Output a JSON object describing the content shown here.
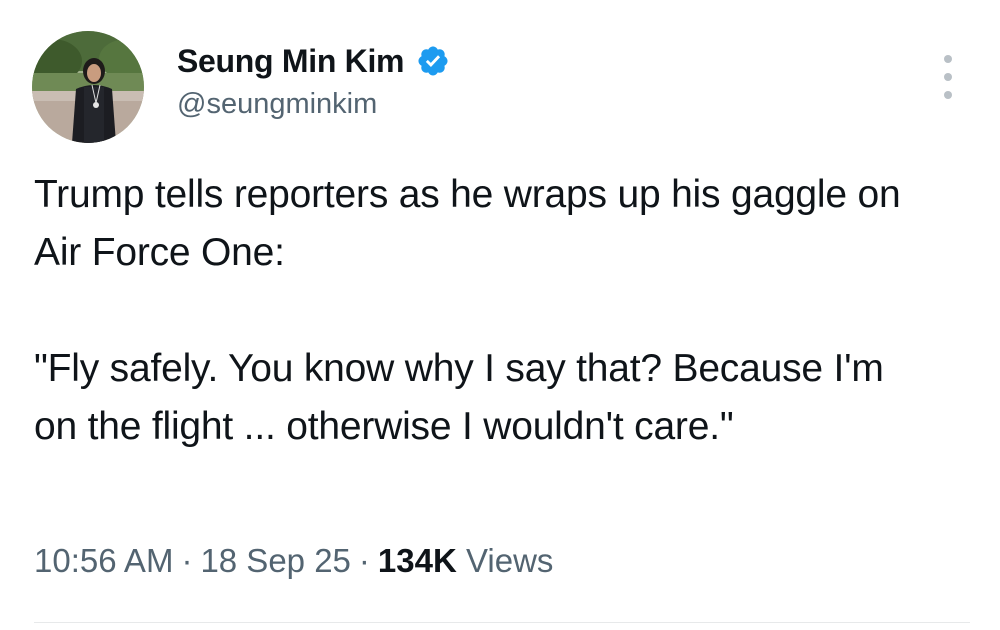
{
  "author": {
    "display_name": "Seung Min Kim",
    "handle": "@seungminkim",
    "verified": true,
    "verified_icon": "verified-badge-icon",
    "verified_color": "#1d9bf0"
  },
  "tweet": {
    "paragraphs": [
      "Trump tells reporters as he wraps up his gaggle on Air Force One:",
      "\"Fly safely. You know why I say that? Because I'm on the flight ... otherwise I wouldn't care.\""
    ],
    "time": "10:56 AM",
    "date": "18 Sep 25",
    "views_count": "134K",
    "views_label": "Views",
    "separator": "·"
  },
  "menu": {
    "icon": "more-options-icon"
  },
  "colors": {
    "text_primary": "#0f1419",
    "text_secondary": "#536471",
    "divider": "#e7e9ea"
  }
}
